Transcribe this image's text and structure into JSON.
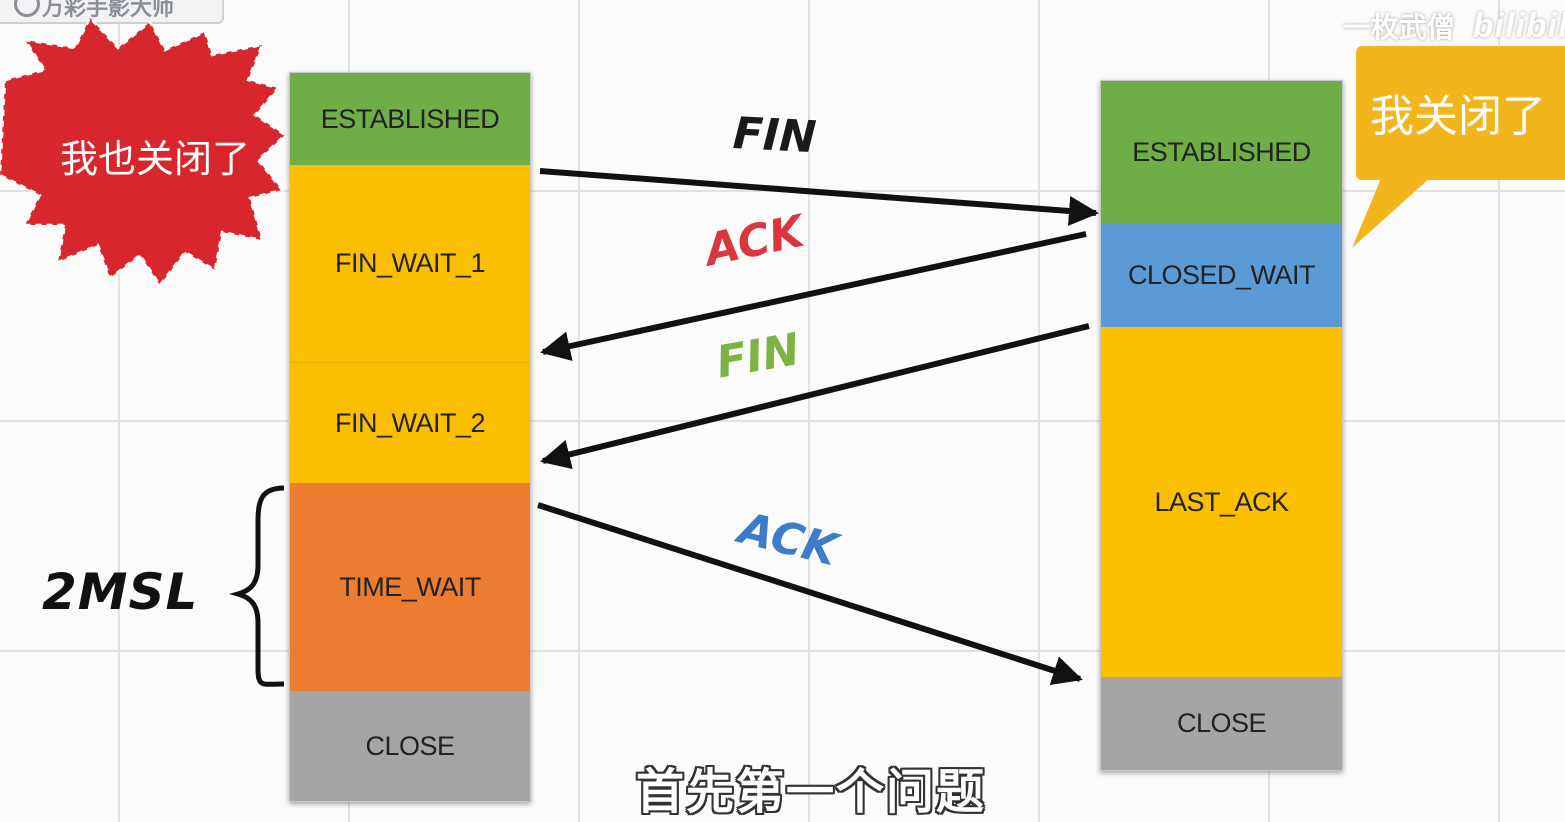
{
  "watermark": {
    "left_text": "万彩手影大师",
    "author": "一枚武僧",
    "brand": "bilibili"
  },
  "client": {
    "callout": "我也关闭了",
    "states": [
      "ESTABLISHED",
      "FIN_WAIT_1",
      "FIN_WAIT_2",
      "TIME_WAIT",
      "CLOSE"
    ]
  },
  "server": {
    "callout": "我关闭了",
    "states": [
      "ESTABLISHED",
      "CLOSED_WAIT",
      "LAST_ACK",
      "CLOSE"
    ]
  },
  "messages": [
    {
      "label": "FIN",
      "color": "#1a1a1a"
    },
    {
      "label": "ACK",
      "color": "#d9363e"
    },
    {
      "label": "FIN",
      "color": "#7cb342"
    },
    {
      "label": "ACK",
      "color": "#3d7cc9"
    }
  ],
  "time_wait_duration": "2MSL",
  "subtitle": "首先第一个问题",
  "colors": {
    "established": "#6fad47",
    "wait": "#fabf00",
    "time_wait": "#ec7c30",
    "close": "#a5a5a5",
    "closed_wait": "#5b9bd5",
    "client_callout": "#d8262e",
    "server_callout": "#f3b51c"
  }
}
